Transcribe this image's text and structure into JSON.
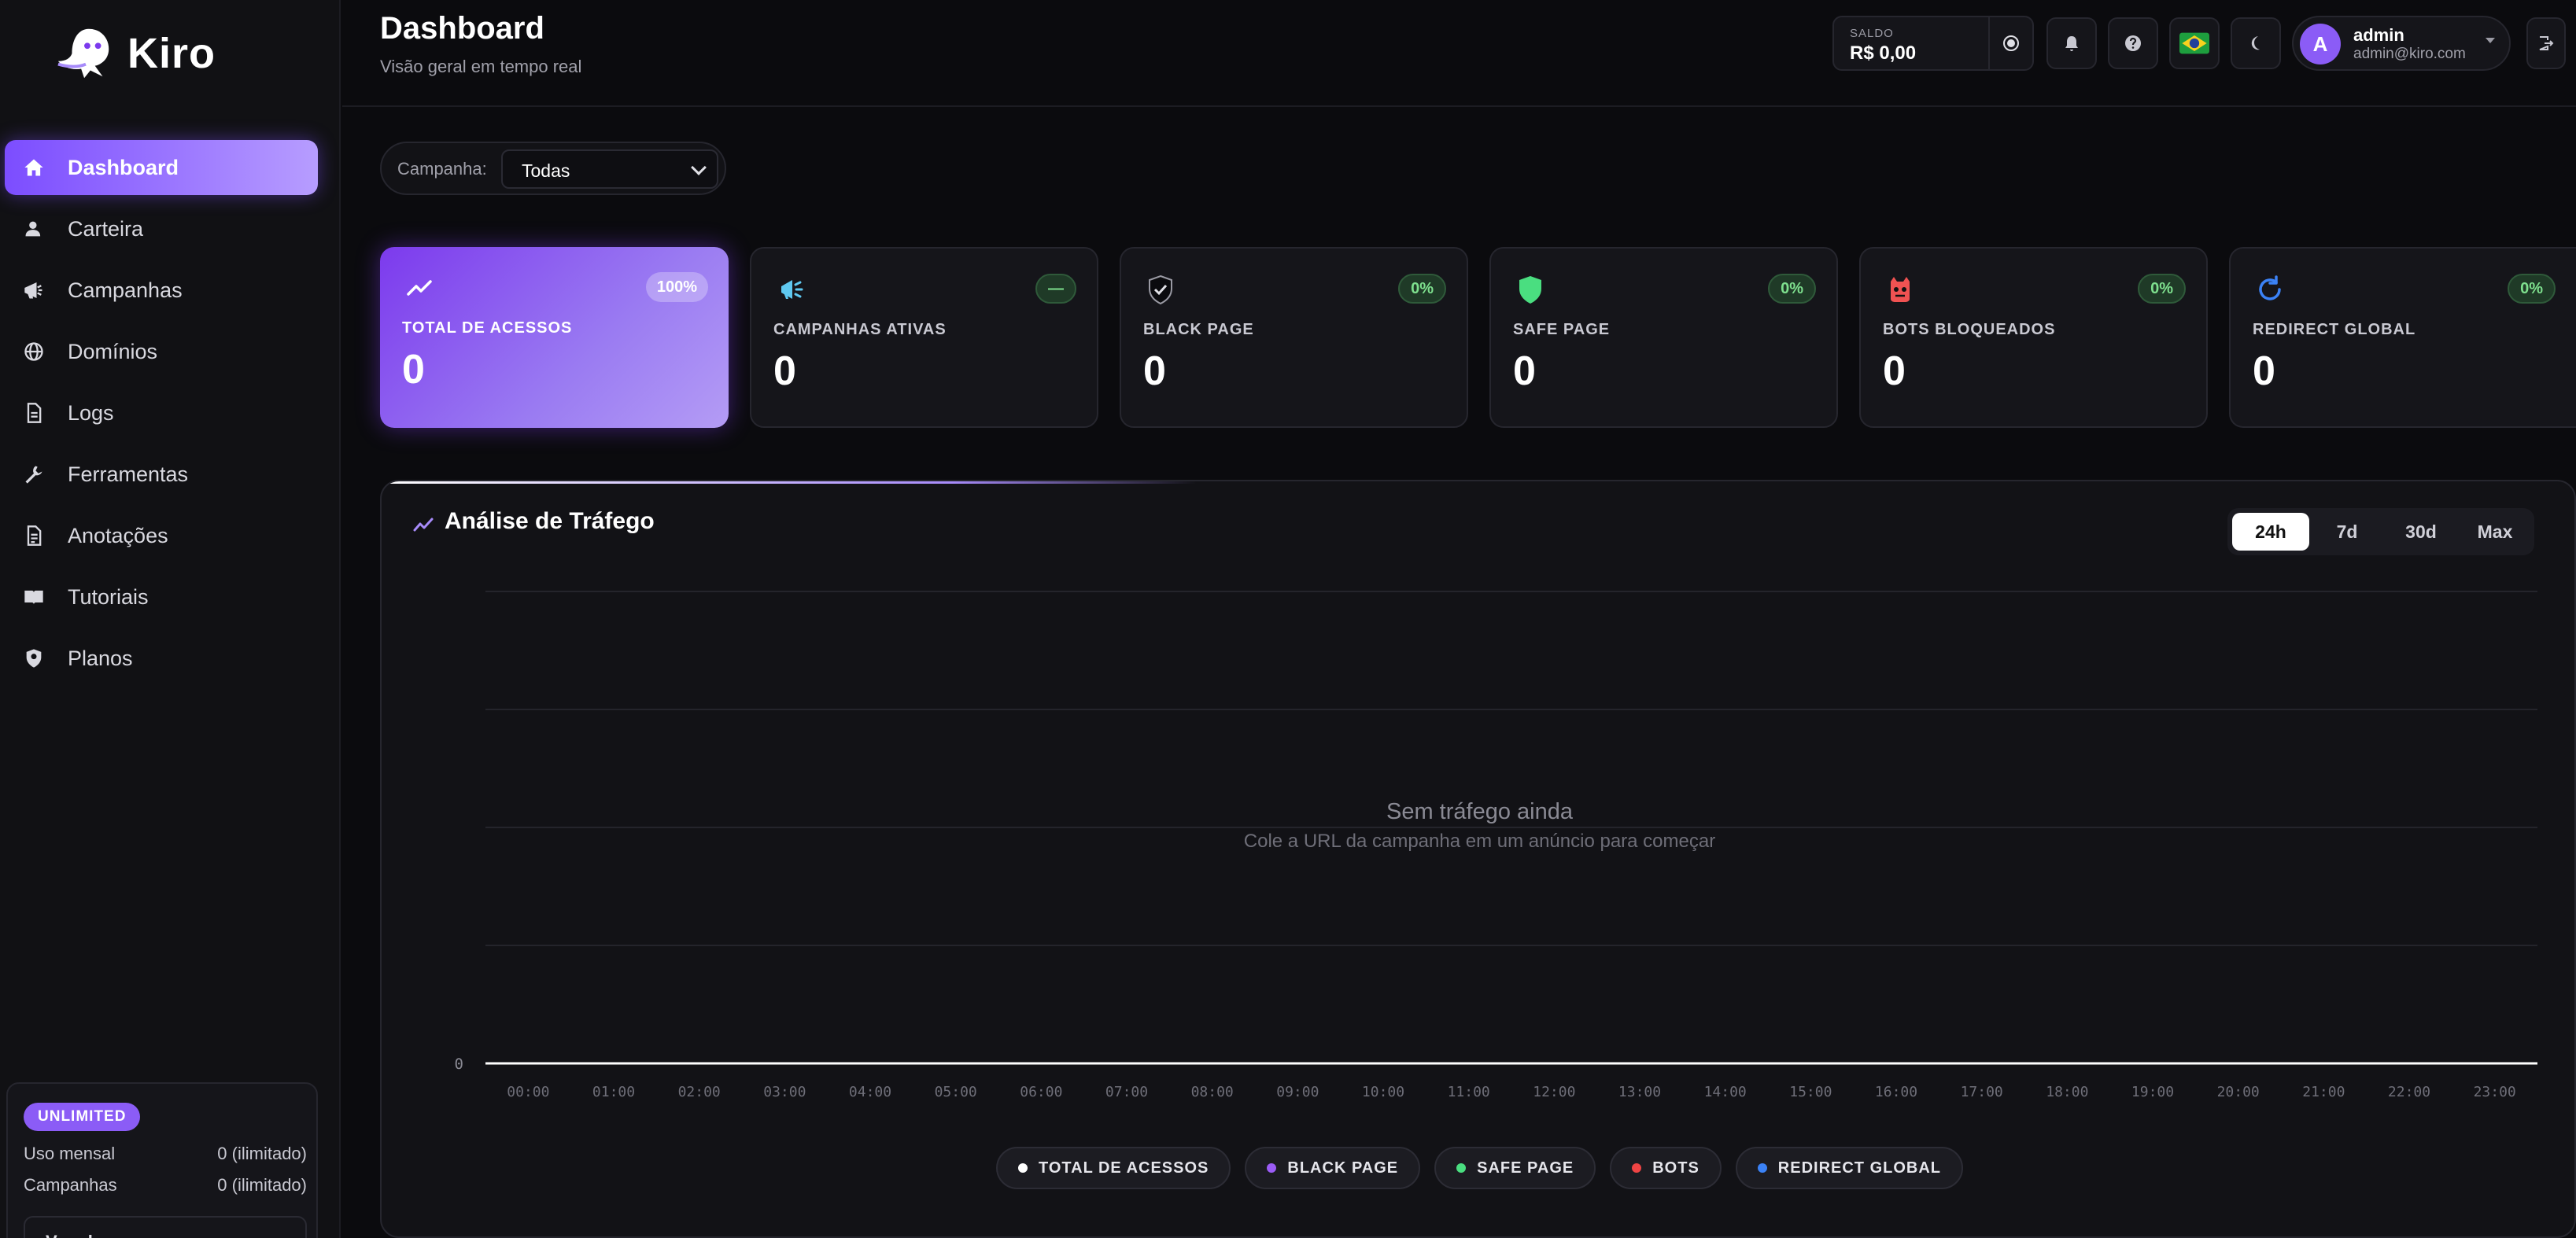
{
  "brand": {
    "name": "Kiro"
  },
  "sidebar": {
    "items": [
      {
        "label": "Dashboard",
        "icon": "home-icon",
        "active": true
      },
      {
        "label": "Carteira",
        "icon": "user-icon"
      },
      {
        "label": "Campanhas",
        "icon": "megaphone-icon"
      },
      {
        "label": "Domínios",
        "icon": "globe-icon"
      },
      {
        "label": "Logs",
        "icon": "document-icon"
      },
      {
        "label": "Ferramentas",
        "icon": "wrench-icon"
      },
      {
        "label": "Anotações",
        "icon": "notes-icon"
      },
      {
        "label": "Tutoriais",
        "icon": "book-icon"
      },
      {
        "label": "Planos",
        "icon": "location-shield-icon"
      }
    ],
    "plan": {
      "badge": "UNLIMITED",
      "monthly_label": "Uso mensal",
      "monthly_value": "0 (ilimitado)",
      "campaigns_label": "Campanhas",
      "campaigns_value": "0 (ilimitado)",
      "button": "Ver planos"
    }
  },
  "header": {
    "title": "Dashboard",
    "subtitle": "Visão geral em tempo real",
    "balance_label": "SALDO",
    "balance_value": "R$ 0,00",
    "user_initial": "A",
    "user_name": "admin",
    "user_email": "admin@kiro.com"
  },
  "filter": {
    "label": "Campanha:",
    "selected": "Todas"
  },
  "cards": [
    {
      "label": "TOTAL DE ACESSOS",
      "value": "0",
      "badge": "100%",
      "icon": "trend-icon"
    },
    {
      "label": "CAMPANHAS ATIVAS",
      "value": "0",
      "badge": "—",
      "icon": "megaphone-icon"
    },
    {
      "label": "BLACK PAGE",
      "value": "0",
      "badge": "0%",
      "icon": "shield-check-icon"
    },
    {
      "label": "SAFE PAGE",
      "value": "0",
      "badge": "0%",
      "icon": "shield-icon"
    },
    {
      "label": "BOTS BLOQUEADOS",
      "value": "0",
      "badge": "0%",
      "icon": "bot-icon"
    },
    {
      "label": "REDIRECT GLOBAL",
      "value": "0",
      "badge": "0%",
      "icon": "refresh-icon"
    }
  ],
  "traffic": {
    "title": "Análise de Tráfego",
    "ranges": [
      "24h",
      "7d",
      "30d",
      "Max"
    ],
    "active_range": "24h",
    "empty_title": "Sem tráfego ainda",
    "empty_subtitle": "Cole a URL da campanha em um anúncio para começar",
    "legend": [
      {
        "label": "TOTAL DE ACESSOS",
        "color": "#ffffff"
      },
      {
        "label": "BLACK PAGE",
        "color": "#9b5cf6"
      },
      {
        "label": "SAFE PAGE",
        "color": "#4ade80"
      },
      {
        "label": "BOTS",
        "color": "#ef4444"
      },
      {
        "label": "REDIRECT GLOBAL",
        "color": "#3b82f6"
      }
    ]
  },
  "chart_data": {
    "type": "line",
    "categories": [
      "00:00",
      "01:00",
      "02:00",
      "03:00",
      "04:00",
      "05:00",
      "06:00",
      "07:00",
      "08:00",
      "09:00",
      "10:00",
      "11:00",
      "12:00",
      "13:00",
      "14:00",
      "15:00",
      "16:00",
      "17:00",
      "18:00",
      "19:00",
      "20:00",
      "21:00",
      "22:00",
      "23:00"
    ],
    "series": [
      {
        "name": "TOTAL DE ACESSOS",
        "values": [
          0,
          0,
          0,
          0,
          0,
          0,
          0,
          0,
          0,
          0,
          0,
          0,
          0,
          0,
          0,
          0,
          0,
          0,
          0,
          0,
          0,
          0,
          0,
          0
        ]
      }
    ],
    "y_ticks": [
      "0"
    ],
    "ylim": [
      0,
      1
    ],
    "grid": true
  },
  "colors": {
    "accent": "#7c4dff",
    "success": "#4ade80",
    "danger": "#ef4444",
    "info": "#3b82f6"
  }
}
